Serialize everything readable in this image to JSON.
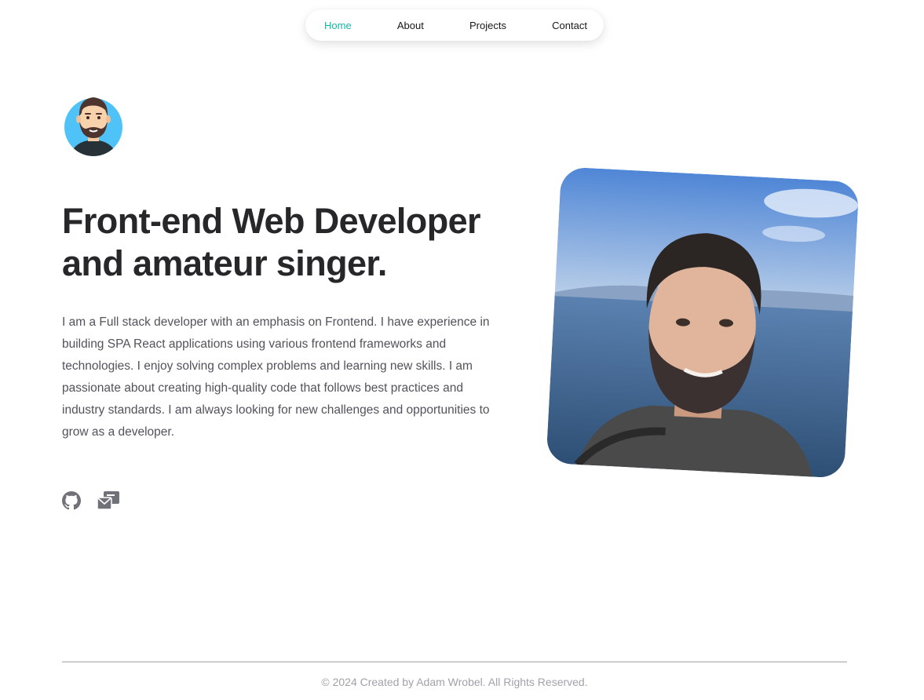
{
  "nav": {
    "items": [
      {
        "label": "Home",
        "active": true
      },
      {
        "label": "About",
        "active": false
      },
      {
        "label": "Projects",
        "active": false
      },
      {
        "label": "Contact",
        "active": false
      }
    ],
    "active_color": "#14b8a6"
  },
  "hero": {
    "headline_line1": "Front-end Web Developer",
    "headline_line2": "and amateur singer.",
    "bio": "I am a Full stack developer with an emphasis on Frontend. I have experience in building SPA React applications using various frontend frameworks and technologies. I enjoy solving complex problems and learning new skills. I am passionate about creating high-quality code that follows best practices and industry standards. I am always looking for new challenges and opportunities to grow as a developer."
  },
  "socials": [
    {
      "icon": "github-icon"
    },
    {
      "icon": "mail-icon"
    }
  ],
  "footer": {
    "text": "© 2024 Created by Adam Wrobel. All Rights Reserved."
  }
}
